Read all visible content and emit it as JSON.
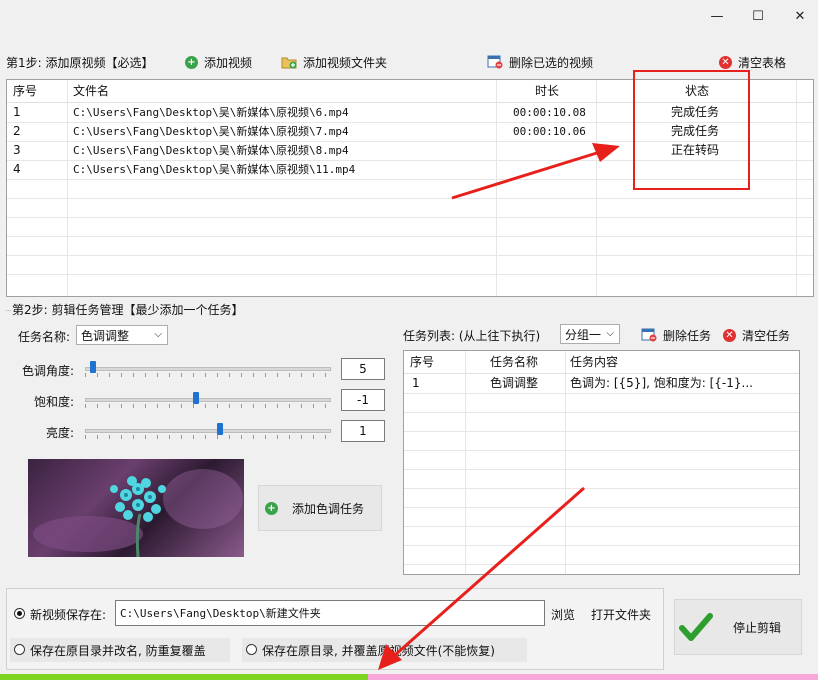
{
  "window": {
    "minimize": "—",
    "maximize": "☐",
    "close": "✕"
  },
  "step1": {
    "label": "第1步: 添加原视频【必选】",
    "add_video": "添加视频",
    "add_folder": "添加视频文件夹",
    "delete_selected": "删除已选的视频",
    "clear_table": "清空表格",
    "columns": {
      "index": "序号",
      "filename": "文件名",
      "duration": "时长",
      "status": "状态"
    },
    "rows": [
      {
        "index": "1",
        "filename": "C:\\Users\\Fang\\Desktop\\吴\\新媒体\\原视频\\6.mp4",
        "duration": "00:00:10.08",
        "status": "完成任务"
      },
      {
        "index": "2",
        "filename": "C:\\Users\\Fang\\Desktop\\吴\\新媒体\\原视频\\7.mp4",
        "duration": "00:00:10.06",
        "status": "完成任务"
      },
      {
        "index": "3",
        "filename": "C:\\Users\\Fang\\Desktop\\吴\\新媒体\\原视频\\8.mp4",
        "duration": "",
        "status": "正在转码"
      },
      {
        "index": "4",
        "filename": "C:\\Users\\Fang\\Desktop\\吴\\新媒体\\原视频\\11.mp4",
        "duration": "",
        "status": ""
      }
    ]
  },
  "step2": {
    "label": "第2步: 剪辑任务管理【最少添加一个任务】",
    "task_name_label": "任务名称:",
    "task_name_value": "色调调整",
    "hue_label": "色调角度:",
    "hue_value": "5",
    "hue_level": 0.02,
    "saturation_label": "饱和度:",
    "saturation_value": "-1",
    "saturation_level": 0.45,
    "brightness_label": "亮度:",
    "brightness_value": "1",
    "brightness_level": 0.55,
    "add_task_button": "添加色调任务",
    "task_list_label": "任务列表: (从上往下执行)",
    "group_value": "分组一",
    "delete_task": "删除任务",
    "clear_tasks": "清空任务",
    "task_columns": {
      "index": "序号",
      "name": "任务名称",
      "content": "任务内容"
    },
    "tasks": [
      {
        "index": "1",
        "name": "色调调整",
        "content": "色调为: [{5}], 饱和度为: [{-1}..."
      }
    ]
  },
  "output": {
    "save_new_label": "新视频保存在:",
    "save_path": "C:\\Users\\Fang\\Desktop\\新建文件夹",
    "browse": "浏览",
    "open_folder": "打开文件夹",
    "save_rename_label": "保存在原目录并改名, 防重复覆盖",
    "save_overwrite_label": "保存在原目录, 并覆盖原视频文件(不能恢复)",
    "stop_button": "停止剪辑",
    "progress": 0.45
  },
  "colors": {
    "highlight": "#e8201c",
    "accent": "#1e73d2",
    "progress_green": "#7ed321",
    "progress_pink": "#f7a8d8"
  }
}
